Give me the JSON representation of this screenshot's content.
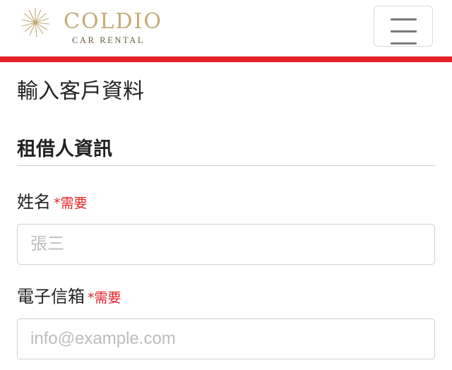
{
  "header": {
    "brand_name": "COLDIO",
    "brand_sub": "CAR RENTAL",
    "menu_button_label": "menu"
  },
  "colors": {
    "brand_gold": "#c2ac78",
    "accent_red": "#e42127",
    "required_red": "#e42127"
  },
  "page": {
    "title": "輸入客戶資料"
  },
  "section": {
    "title": "租借人資訊"
  },
  "form": {
    "fields": [
      {
        "label": "姓名",
        "required_text": "*需要",
        "value": "",
        "placeholder": "張三"
      },
      {
        "label": "電子信箱",
        "required_text": "*需要",
        "value": "",
        "placeholder": "info@example.com"
      }
    ]
  },
  "icons": {
    "logo": "sunburst-logo-icon",
    "menu": "hamburger-menu-icon"
  }
}
